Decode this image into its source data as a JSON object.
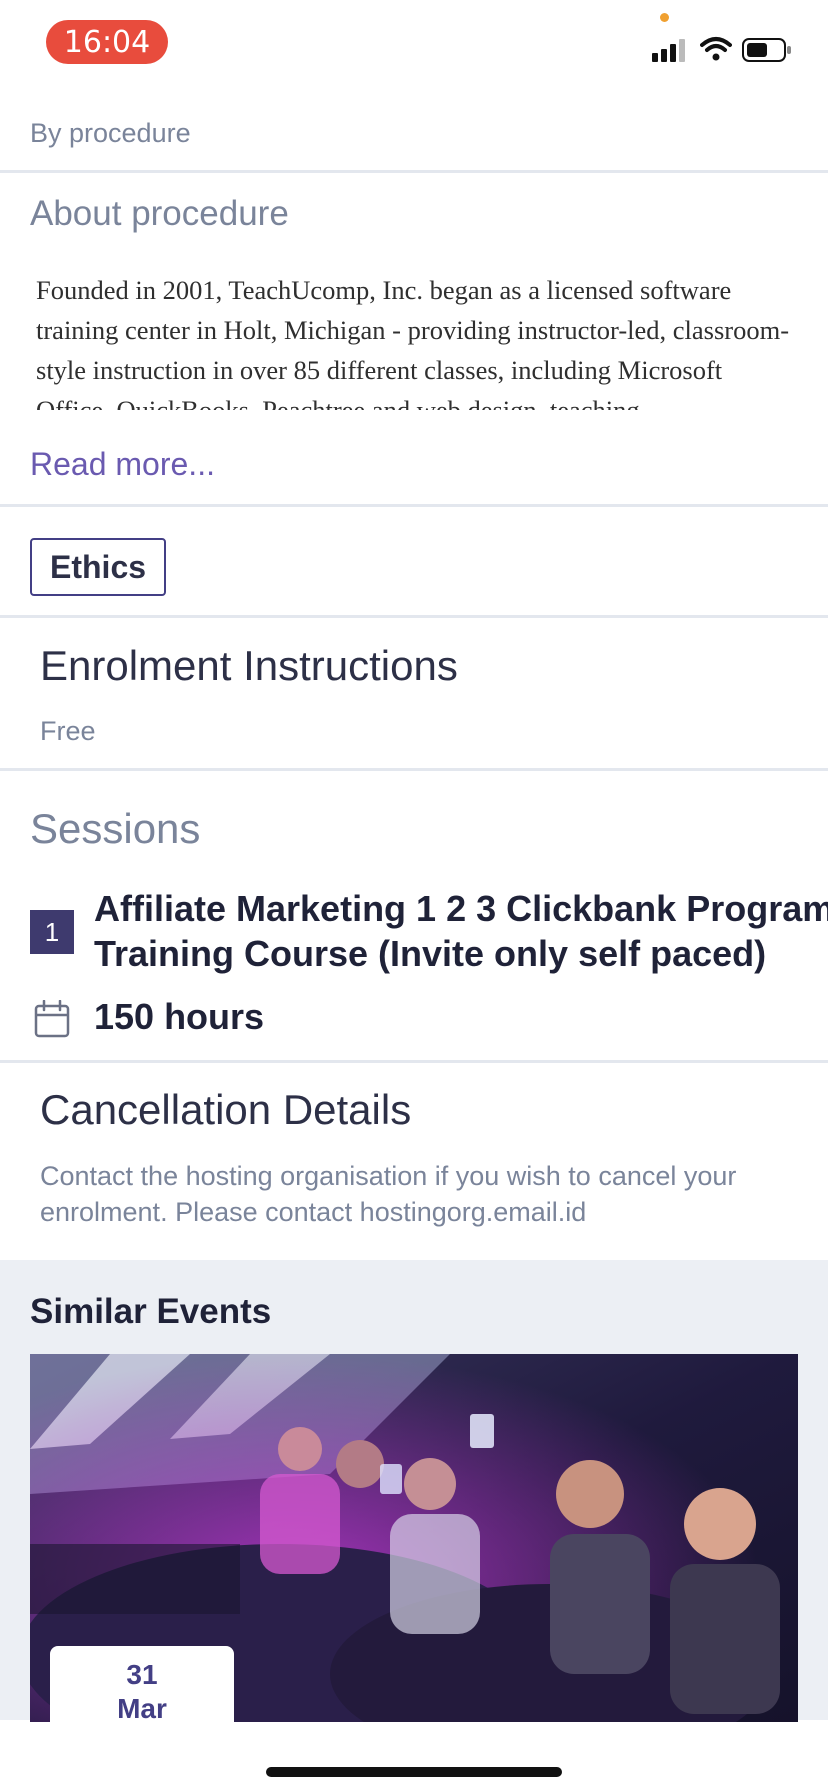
{
  "status_bar": {
    "time": "16:04"
  },
  "organiser": {
    "label": "By procedure"
  },
  "about": {
    "title": "About procedure",
    "body": "Founded in 2001, TeachUcomp, Inc. began as a licensed software training center in Holt, Michigan - providing instructor-led, classroom-style instruction in over 85 different classes, including Microsoft Office, QuickBooks, Peachtree and web design, teaching",
    "read_more": "Read more..."
  },
  "tags": [
    "Ethics"
  ],
  "enrolment": {
    "title": "Enrolment Instructions",
    "price": "Free"
  },
  "sessions": {
    "title": "Sessions",
    "items": [
      {
        "number": "1",
        "name_line1": "Affiliate Marketing 1 2 3 Clickbank Program",
        "name_line2": "Training Course (Invite only self paced)",
        "duration": "150 hours"
      }
    ]
  },
  "cancellation": {
    "title": "Cancellation Details",
    "body": "Contact the hosting organisation if you wish to cancel your enrolment. Please contact hostingorg.email.id"
  },
  "similar_events": {
    "title": "Similar Events",
    "items": [
      {
        "day": "31",
        "month": "Mar"
      }
    ]
  },
  "colors": {
    "accent": "#433f85",
    "link": "#6a5ab0",
    "muted": "#7a849a",
    "time_pill": "#e84c3d"
  }
}
